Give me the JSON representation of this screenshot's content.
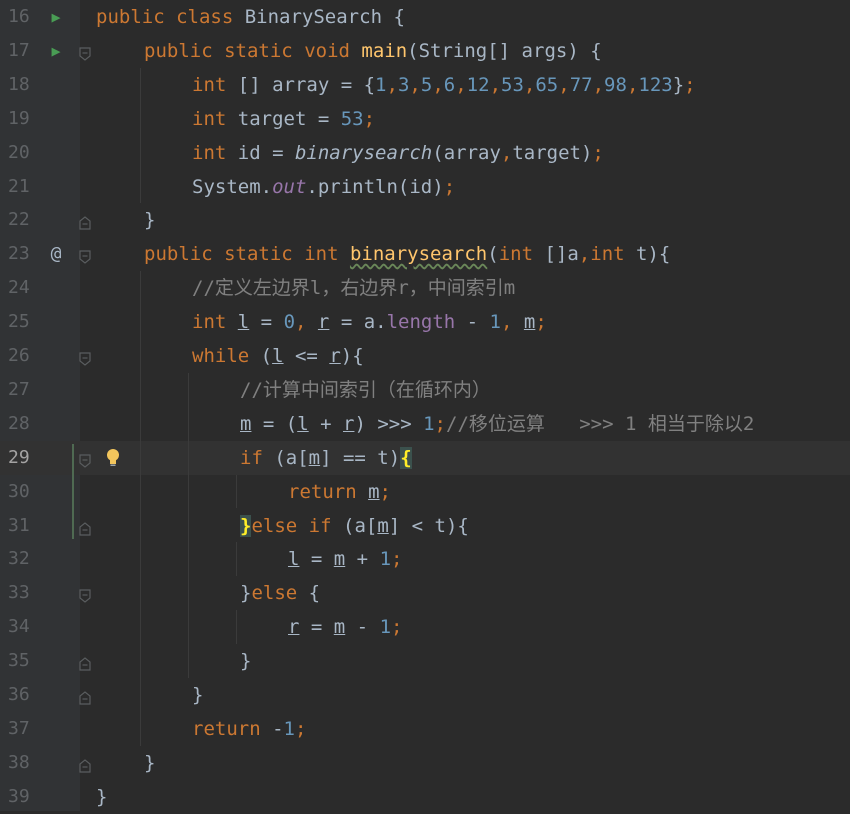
{
  "editor": {
    "lines": [
      {
        "no": "16",
        "gutter": "run",
        "fold": "none",
        "indent": 0,
        "tokens": [
          [
            "kw",
            "public"
          ],
          [
            "",
            "␠"
          ],
          [
            "kw",
            "class"
          ],
          [
            "",
            "␠BinarySearch␠{"
          ]
        ]
      },
      {
        "no": "17",
        "gutter": "run",
        "fold": "open",
        "indent": 1,
        "tokens": [
          [
            "kw",
            "public"
          ],
          [
            "",
            "␠"
          ],
          [
            "kw",
            "static"
          ],
          [
            "",
            "␠"
          ],
          [
            "kw",
            "void"
          ],
          [
            "",
            "␠"
          ],
          [
            "fn",
            "main"
          ],
          [
            "",
            "(String[]␠args)␠{"
          ]
        ]
      },
      {
        "no": "18",
        "gutter": "",
        "fold": "none",
        "indent": 2,
        "tokens": [
          [
            "kw",
            "int"
          ],
          [
            "",
            "␠[]␠array␠=␠{"
          ],
          [
            "num",
            "1"
          ],
          [
            "kw",
            ","
          ],
          [
            "num",
            "3"
          ],
          [
            "kw",
            ","
          ],
          [
            "num",
            "5"
          ],
          [
            "kw",
            ","
          ],
          [
            "num",
            "6"
          ],
          [
            "kw",
            ","
          ],
          [
            "num",
            "12"
          ],
          [
            "kw",
            ","
          ],
          [
            "num",
            "53"
          ],
          [
            "kw",
            ","
          ],
          [
            "num",
            "65"
          ],
          [
            "kw",
            ","
          ],
          [
            "num",
            "77"
          ],
          [
            "kw",
            ","
          ],
          [
            "num",
            "98"
          ],
          [
            "kw",
            ","
          ],
          [
            "num",
            "123"
          ],
          [
            "",
            "}"
          ],
          [
            "kw",
            ";"
          ]
        ]
      },
      {
        "no": "19",
        "gutter": "",
        "fold": "none",
        "indent": 2,
        "tokens": [
          [
            "kw",
            "int"
          ],
          [
            "",
            "␠target␠=␠"
          ],
          [
            "num",
            "53"
          ],
          [
            "kw",
            ";"
          ]
        ]
      },
      {
        "no": "20",
        "gutter": "",
        "fold": "none",
        "indent": 2,
        "tokens": [
          [
            "kw",
            "int"
          ],
          [
            "",
            "␠id␠=␠"
          ],
          [
            "it",
            "binarysearch"
          ],
          [
            "",
            "(array"
          ],
          [
            "kw",
            ","
          ],
          [
            "",
            "target)"
          ],
          [
            "kw",
            ";"
          ]
        ]
      },
      {
        "no": "21",
        "gutter": "",
        "fold": "none",
        "indent": 2,
        "tokens": [
          [
            "",
            "System."
          ],
          [
            "field",
            "out"
          ],
          [
            "",
            ".println(id)"
          ],
          [
            "kw",
            ";"
          ]
        ]
      },
      {
        "no": "22",
        "gutter": "",
        "fold": "close",
        "indent": 1,
        "tokens": [
          [
            "",
            "}"
          ]
        ]
      },
      {
        "no": "23",
        "gutter": "at",
        "fold": "open",
        "indent": 1,
        "tokens": [
          [
            "kw",
            "public"
          ],
          [
            "",
            "␠"
          ],
          [
            "kw",
            "static"
          ],
          [
            "",
            "␠"
          ],
          [
            "kw",
            "int"
          ],
          [
            "",
            "␠"
          ],
          [
            "fnw",
            "binarysearch"
          ],
          [
            "",
            "("
          ],
          [
            "kw",
            "int"
          ],
          [
            "",
            "␠[]a"
          ],
          [
            "kw",
            ","
          ],
          [
            "kw",
            "int"
          ],
          [
            "",
            "␠t){"
          ]
        ]
      },
      {
        "no": "24",
        "gutter": "",
        "fold": "none",
        "indent": 2,
        "tokens": [
          [
            "cmt",
            "//定义左边界l，右边界r，中间索引m"
          ]
        ]
      },
      {
        "no": "25",
        "gutter": "",
        "fold": "none",
        "indent": 2,
        "tokens": [
          [
            "kw",
            "int"
          ],
          [
            "",
            "␠"
          ],
          [
            "ul",
            "l"
          ],
          [
            "",
            "␠=␠"
          ],
          [
            "num",
            "0"
          ],
          [
            "kw",
            ","
          ],
          [
            "",
            "␠"
          ],
          [
            "ul",
            "r"
          ],
          [
            "",
            "␠=␠a."
          ],
          [
            "prop",
            "length"
          ],
          [
            "",
            "␠-␠"
          ],
          [
            "num",
            "1"
          ],
          [
            "kw",
            ","
          ],
          [
            "",
            "␠"
          ],
          [
            "ul",
            "m"
          ],
          [
            "kw",
            ";"
          ]
        ]
      },
      {
        "no": "26",
        "gutter": "",
        "fold": "open",
        "indent": 2,
        "tokens": [
          [
            "kw",
            "while"
          ],
          [
            "",
            "␠("
          ],
          [
            "ul",
            "l"
          ],
          [
            "",
            "␠<=␠"
          ],
          [
            "ul",
            "r"
          ],
          [
            "",
            "){"
          ]
        ]
      },
      {
        "no": "27",
        "gutter": "",
        "fold": "none",
        "indent": 3,
        "tokens": [
          [
            "cmt",
            "//计算中间索引（在循环内）"
          ]
        ]
      },
      {
        "no": "28",
        "gutter": "",
        "fold": "none",
        "indent": 3,
        "tokens": [
          [
            "ul",
            "m"
          ],
          [
            "",
            "␠=␠("
          ],
          [
            "ul",
            "l"
          ],
          [
            "",
            "␠+␠"
          ],
          [
            "ul",
            "r"
          ],
          [
            "",
            ")␠>>>␠"
          ],
          [
            "num",
            "1"
          ],
          [
            "kw",
            ";"
          ],
          [
            "cmt",
            "//移位运算␠␠␠>>>␠1␠相当于除以2"
          ]
        ]
      },
      {
        "no": "29",
        "gutter": "",
        "fold": "open",
        "indent": 3,
        "current": true,
        "bulb": true,
        "tokens": [
          [
            "kw",
            "if"
          ],
          [
            "",
            "␠(a["
          ],
          [
            "ul",
            "m"
          ],
          [
            "",
            "]␠==␠t)"
          ],
          [
            "bm",
            "{"
          ]
        ]
      },
      {
        "no": "30",
        "gutter": "",
        "fold": "none",
        "indent": 4,
        "tokens": [
          [
            "kw",
            "return"
          ],
          [
            "",
            "␠"
          ],
          [
            "ul",
            "m"
          ],
          [
            "kw",
            ";"
          ]
        ]
      },
      {
        "no": "31",
        "gutter": "",
        "fold": "close",
        "indent": 3,
        "tokens": [
          [
            "bm",
            "}"
          ],
          [
            "kw",
            "else"
          ],
          [
            "",
            "␠"
          ],
          [
            "kw",
            "if"
          ],
          [
            "",
            "␠(a["
          ],
          [
            "ul",
            "m"
          ],
          [
            "",
            "]␠<␠t){"
          ]
        ]
      },
      {
        "no": "32",
        "gutter": "",
        "fold": "none",
        "indent": 4,
        "tokens": [
          [
            "ul",
            "l"
          ],
          [
            "",
            "␠=␠"
          ],
          [
            "ul",
            "m"
          ],
          [
            "",
            "␠+␠"
          ],
          [
            "num",
            "1"
          ],
          [
            "kw",
            ";"
          ]
        ]
      },
      {
        "no": "33",
        "gutter": "",
        "fold": "open",
        "indent": 3,
        "tokens": [
          [
            "",
            "}"
          ],
          [
            "kw",
            "else"
          ],
          [
            "",
            "␠{"
          ]
        ]
      },
      {
        "no": "34",
        "gutter": "",
        "fold": "none",
        "indent": 4,
        "tokens": [
          [
            "ul",
            "r"
          ],
          [
            "",
            "␠=␠"
          ],
          [
            "ul",
            "m"
          ],
          [
            "",
            "␠-␠"
          ],
          [
            "num",
            "1"
          ],
          [
            "kw",
            ";"
          ]
        ]
      },
      {
        "no": "35",
        "gutter": "",
        "fold": "close",
        "indent": 3,
        "tokens": [
          [
            "",
            "}"
          ]
        ]
      },
      {
        "no": "36",
        "gutter": "",
        "fold": "close",
        "indent": 2,
        "tokens": [
          [
            "",
            "}"
          ]
        ]
      },
      {
        "no": "37",
        "gutter": "",
        "fold": "none",
        "indent": 2,
        "tokens": [
          [
            "kw",
            "return"
          ],
          [
            "",
            "␠-"
          ],
          [
            "num",
            "1"
          ],
          [
            "kw",
            ";"
          ]
        ]
      },
      {
        "no": "38",
        "gutter": "",
        "fold": "close",
        "indent": 1,
        "tokens": [
          [
            "",
            "}"
          ]
        ]
      },
      {
        "no": "39",
        "gutter": "",
        "fold": "none",
        "indent": 0,
        "tokens": [
          [
            "",
            "}"
          ]
        ]
      }
    ],
    "colors": {
      "background": "#2b2b2b",
      "keyword": "#cc7832",
      "number": "#6897bb",
      "method": "#ffc66d",
      "field": "#9876aa",
      "comment": "#808080",
      "run_icon": "#499c54"
    }
  }
}
